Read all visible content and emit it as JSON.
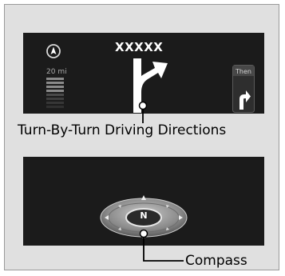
{
  "turn_by_turn": {
    "street_name": "XXXXX",
    "distance": "20 mi",
    "next_label": "Then",
    "caption": "Turn-By-Turn Driving Directions"
  },
  "compass": {
    "heading": "N",
    "caption": "Compass"
  },
  "icons": {
    "compass_indicator": "navigation-compass-icon",
    "main_maneuver": "keep-right-arrow-icon",
    "next_maneuver": "turn-right-arrow-icon"
  }
}
